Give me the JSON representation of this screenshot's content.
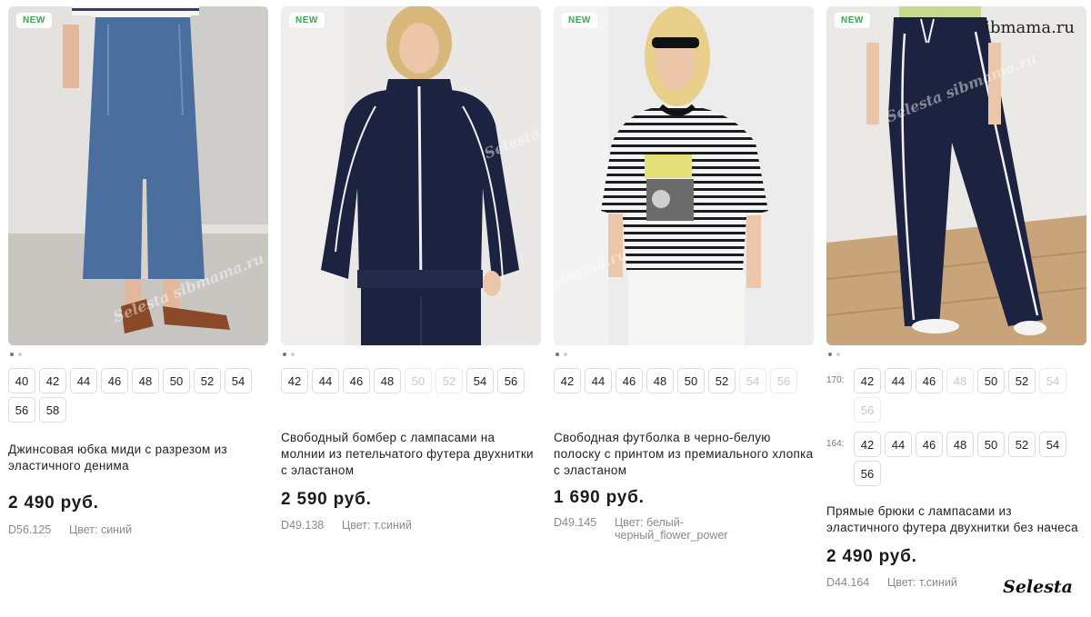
{
  "products": [
    {
      "badge": "NEW",
      "sizes": [
        "40",
        "42",
        "44",
        "46",
        "48",
        "50",
        "52",
        "54",
        "56",
        "58"
      ],
      "name": "Джинсовая юбка миди с разрезом из эластичного денима",
      "price": "2 490 руб.",
      "sku": "D56.125",
      "color": "Цвет: синий",
      "watermark": "Selesta sibmama.ru"
    },
    {
      "badge": "NEW",
      "sizes": [
        "42",
        "44",
        "46",
        "48",
        "50",
        "52",
        "54",
        "56"
      ],
      "unavailable_sizes": [
        "50",
        "52"
      ],
      "name": "Свободный бомбер с лампасами на молнии из петельчатого футера двухнитки с эластаном",
      "price": "2 590 руб.",
      "sku": "D49.138",
      "color": "Цвет: т.синий",
      "watermark": "Selesta sibmama.ru"
    },
    {
      "badge": "NEW",
      "sizes": [
        "42",
        "44",
        "46",
        "48",
        "50",
        "52",
        "54",
        "56"
      ],
      "unavailable_sizes": [
        "54",
        "56"
      ],
      "name": "Свободная футболка в черно-белую полоску с принтом из премиального хлопка с эластаном",
      "price": "1 690 руб.",
      "sku": "D49.145",
      "color": "Цвет: белый-черный_flower_power",
      "watermark": "Selesta sibmama.ru"
    },
    {
      "badge": "NEW",
      "size_rows": [
        {
          "label": "170:",
          "sizes": [
            "42",
            "44",
            "46",
            "48",
            "50",
            "52",
            "54",
            "56"
          ],
          "unavailable_sizes": [
            "48",
            "54",
            "56"
          ]
        },
        {
          "label": "164:",
          "sizes": [
            "42",
            "44",
            "46",
            "48",
            "50",
            "52",
            "54",
            "56"
          ],
          "unavailable_sizes": []
        }
      ],
      "name": "Прямые брюки с лампасами из эластичного футера двухнитки без начеса",
      "price": "2 490 руб.",
      "sku": "D44.164",
      "color": "Цвет: т.синий",
      "watermark": "Selesta sibmama.ru"
    }
  ],
  "site_watermark": "sibmama.ru",
  "brand_watermark": "Selesta",
  "colors": {
    "badge_text": "#3aa84a",
    "navy": "#1c2340",
    "denim": "#4a6f9e"
  }
}
